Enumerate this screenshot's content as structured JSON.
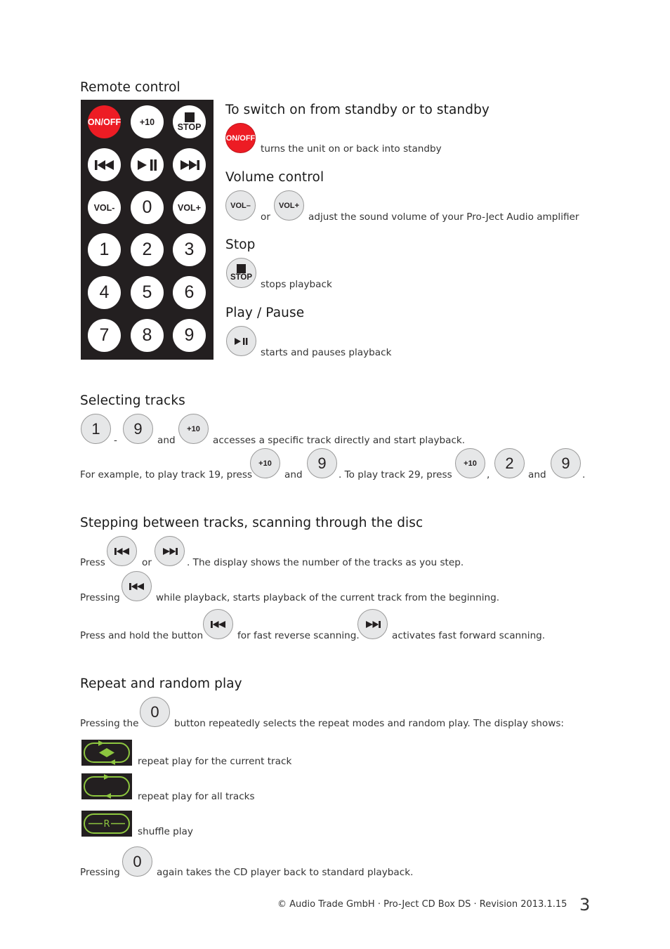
{
  "remote": {
    "title": "Remote control",
    "buttons": {
      "on_off": "ON/OFF",
      "plus10": "+10",
      "stop": "STOP",
      "vol_minus": "VOL-",
      "zero": "0",
      "vol_plus": "VOL+",
      "one": "1",
      "two": "2",
      "three": "3",
      "four": "4",
      "five": "5",
      "six": "6",
      "seven": "7",
      "eight": "8",
      "nine": "9"
    },
    "colors": {
      "body": "#231f20",
      "power": "#ed1c24",
      "button": "#ffffff"
    }
  },
  "standby": {
    "heading": "To switch on from standby or to standby",
    "button": "ON/OFF",
    "text": "turns the unit on or back into standby"
  },
  "volume": {
    "heading": "Volume control",
    "minus": "VOL–",
    "plus": "VOL+",
    "or": "or",
    "text": "adjust the sound volume of your Pro-Ject Audio amplifier"
  },
  "stop": {
    "heading": "Stop",
    "button": "STOP",
    "text": "stops playback"
  },
  "playpause": {
    "heading": "Play / Pause",
    "text": "starts and pauses playback"
  },
  "selecting": {
    "heading": "Selecting tracks",
    "btn1": "1",
    "dash": "-",
    "btn9": "9",
    "and": "and",
    "plus10": "+10",
    "text1": "accesses a specific track directly and start playback.",
    "example_prefix": "For example, to play track 19, press",
    "example_and": "and",
    "example_mid": ". To play track 29, press",
    "comma": ",",
    "btn2": "2",
    "period": "."
  },
  "stepping": {
    "heading": "Stepping between tracks, scanning through the disc",
    "press": "Press",
    "or": "or",
    "line1_text": ". The display shows the number of the tracks as you step.",
    "pressing": "Pressing",
    "line2_text": "while playback, starts playback of the current track from the beginning.",
    "line3_prefix": "Press and hold the button",
    "line3_mid": "for fast reverse scanning.",
    "line3_end": "activates fast forward scanning."
  },
  "repeat": {
    "heading": "Repeat and random play",
    "pressing_the": "Pressing the",
    "btn0": "0",
    "line1_text": "button repeatedly selects the repeat modes and random play. The display shows:",
    "modes": [
      {
        "icon": "repeat-one-icon",
        "text": "repeat play for the current track"
      },
      {
        "icon": "repeat-all-icon",
        "text": "repeat play for all tracks"
      },
      {
        "icon": "shuffle-icon",
        "text": "shuffle play",
        "glyph": "R"
      }
    ],
    "pressing": "Pressing",
    "last_text": "again takes the CD player back to standard playback.",
    "display_color": "#8dc63f"
  },
  "footer": {
    "text": "© Audio Trade GmbH · Pro-Ject CD Box DS · Revision 2013.1.15",
    "page_number": "3"
  }
}
